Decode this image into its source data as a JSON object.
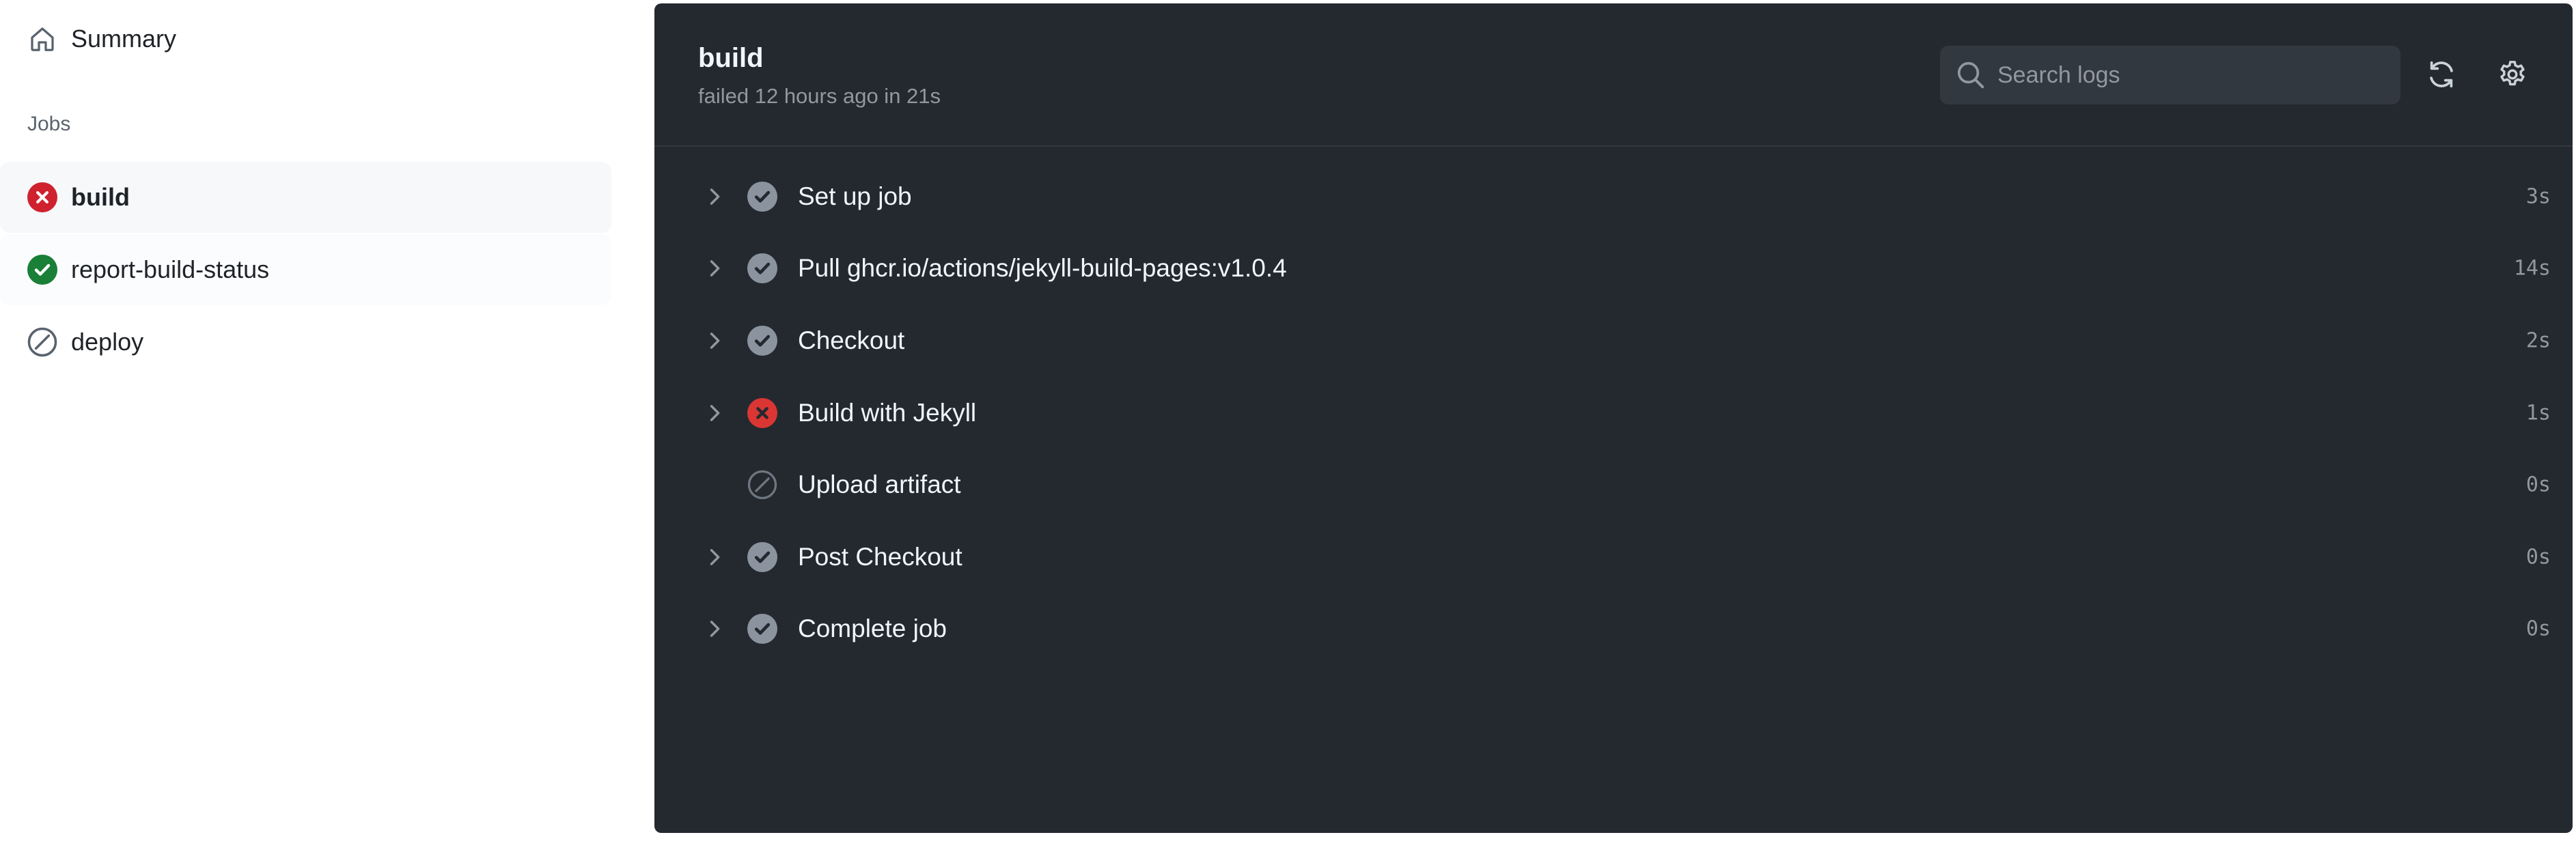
{
  "sidebar": {
    "summary": {
      "label": "Summary",
      "icon": "home-icon"
    },
    "jobs_heading": "Jobs",
    "jobs": [
      {
        "label": "build",
        "status": "failure",
        "icon": "x-circle-fill-icon"
      },
      {
        "label": "report-build-status",
        "status": "success",
        "icon": "check-circle-fill-icon"
      },
      {
        "label": "deploy",
        "status": "skipped",
        "icon": "skip-icon"
      }
    ]
  },
  "job": {
    "title": "build",
    "subtitle": "failed 12 hours ago in 21s"
  },
  "search": {
    "placeholder": "Search logs"
  },
  "toolbar": {
    "refresh_icon": "sync-icon",
    "settings_icon": "gear-icon"
  },
  "steps": [
    {
      "name": "Set up job",
      "duration": "3s",
      "status": "success",
      "expandable": true
    },
    {
      "name": "Pull ghcr.io/actions/jekyll-build-pages:v1.0.4",
      "duration": "14s",
      "status": "success",
      "expandable": true
    },
    {
      "name": "Checkout",
      "duration": "2s",
      "status": "success",
      "expandable": true
    },
    {
      "name": "Build with Jekyll",
      "duration": "1s",
      "status": "failure",
      "expandable": true
    },
    {
      "name": "Upload artifact",
      "duration": "0s",
      "status": "skipped",
      "expandable": false
    },
    {
      "name": "Post Checkout",
      "duration": "0s",
      "status": "success",
      "expandable": true
    },
    {
      "name": "Complete job",
      "duration": "0s",
      "status": "success",
      "expandable": true
    }
  ],
  "colors": {
    "failure": "#cf222e",
    "success": "#1a7f37",
    "panel_bg": "#24292f",
    "step_success": "#8b949e",
    "step_failure": "#da3633"
  }
}
